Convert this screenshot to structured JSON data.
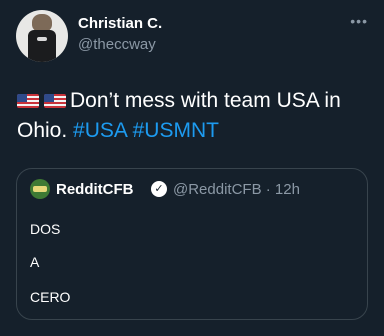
{
  "author": {
    "name": "Christian C.",
    "handle": "@theccway"
  },
  "more_label": "•••",
  "tweet": {
    "text": "Don’t mess with team USA in Ohio.",
    "hashtags": [
      "#USA",
      "#USMNT"
    ]
  },
  "quoted": {
    "name": "RedditCFB",
    "verified_symbol": "✓",
    "handle_time": "@RedditCFB · 12h",
    "lines": [
      "DOS",
      "A",
      "CERO"
    ]
  },
  "colors": {
    "background": "#15202b",
    "link": "#1d9bf0",
    "secondary_text": "#8b98a5",
    "border": "#38444d"
  }
}
